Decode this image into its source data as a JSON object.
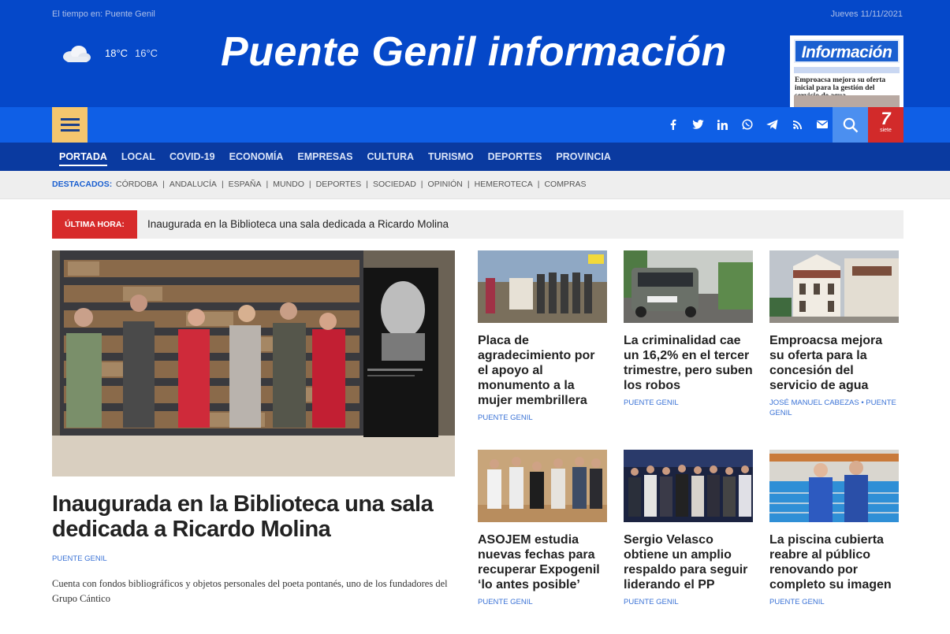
{
  "header": {
    "weather_label": "El tiempo en: Puente Genil",
    "date": "Jueves 11/11/2021",
    "temp_high": "18°C",
    "temp_low": "16°C",
    "weather_icon": "cloud-icon",
    "logo": "Puente Genil información",
    "newspaper": {
      "masthead": "Información",
      "headline": "Emproacsa mejora su oferta inicial para la gestión del servicio de agua"
    }
  },
  "toolbar": {
    "menu_icon": "hamburger-icon",
    "social_icons": [
      "facebook-icon",
      "twitter-icon",
      "linkedin-icon",
      "whatsapp-icon",
      "telegram-icon",
      "rss-icon",
      "email-icon"
    ],
    "search_icon": "search-icon",
    "tv_logo": "7",
    "tv_logo_sub": "siete"
  },
  "nav": {
    "items": [
      "PORTADA",
      "LOCAL",
      "COVID-19",
      "ECONOMÍA",
      "EMPRESAS",
      "CULTURA",
      "TURISMO",
      "DEPORTES",
      "PROVINCIA"
    ],
    "active": "PORTADA"
  },
  "featured": {
    "label": "DESTACADOS:",
    "items": [
      "CÓRDOBA",
      "ANDALUCÍA",
      "ESPAÑA",
      "MUNDO",
      "DEPORTES",
      "SOCIEDAD",
      "OPINIÓN",
      "HEMEROTECA",
      "COMPRAS"
    ]
  },
  "breaking": {
    "tag": "ÚLTIMA HORA:",
    "text": "Inaugurada en la Biblioteca una sala dedicada a Ricardo Molina"
  },
  "hero": {
    "title": "Inaugurada en la Biblioteca una sala dedicada a Ricardo Molina",
    "category": "PUENTE GENIL",
    "description": "Cuenta con fondos bibliográficos y objetos personales del poeta pontanés, uno de los fundadores del Grupo Cántico"
  },
  "cards": [
    {
      "title": "Placa de agradecimiento por el apoyo al monumento a la mujer membrillera",
      "category": "PUENTE GENIL",
      "author": ""
    },
    {
      "title": "La criminalidad cae un 16,2% en el tercer trimestre, pero suben los robos",
      "category": "PUENTE GENIL",
      "author": ""
    },
    {
      "title": "Emproacsa mejora su oferta para la concesión del servicio de agua",
      "category": "PUENTE GENIL",
      "author": "JOSÉ MANUEL CABEZAS"
    },
    {
      "title": "ASOJEM estudia nuevas fechas para recuperar Expogenil ‘lo antes posible’",
      "category": "PUENTE GENIL",
      "author": ""
    },
    {
      "title": "Sergio Velasco obtiene un amplio respaldo para seguir liderando el PP",
      "category": "PUENTE GENIL",
      "author": ""
    },
    {
      "title": "La piscina cubierta reabre al público renovando por completo su imagen",
      "category": "PUENTE GENIL",
      "author": ""
    }
  ]
}
